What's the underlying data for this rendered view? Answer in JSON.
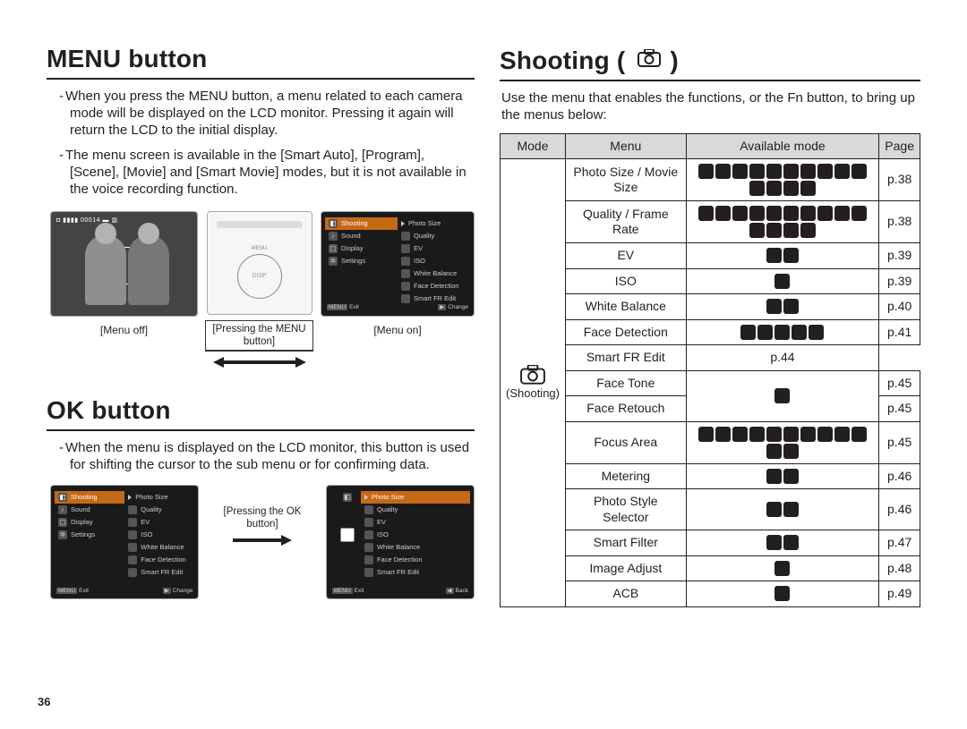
{
  "page_number": "36",
  "left": {
    "menu_heading": "MENU button",
    "menu_p1": "When you press the MENU button, a menu related to each camera mode will be displayed on the LCD monitor. Pressing it again will return the LCD to the initial display.",
    "menu_p2": "The menu screen is available in the [Smart Auto], [Program], [Scene], [Movie] and [Smart Movie] modes, but it is not available in the voice recording function.",
    "fig_menuoff": "[Menu off]",
    "fig_pressing": "[Pressing the MENU button]",
    "fig_menuon": "[Menu on]",
    "menu_left_items": [
      "Shooting",
      "Sound",
      "Display",
      "Settings"
    ],
    "menu_right_items": [
      "Photo Size",
      "Quality",
      "EV",
      "ISO",
      "White Balance",
      "Face Detection",
      "Smart FR Edit"
    ],
    "menu_foot_exit": "Exit",
    "menu_foot_change": "Change",
    "menu_foot_back": "Back",
    "menu_foot_menu": "MENU",
    "ok_heading": "OK button",
    "ok_p1": "When the menu is displayed on the LCD monitor, this button is used for shifting the cursor to the sub menu or for confirming data.",
    "ok_pressing": "[Pressing the OK button]",
    "cam_disp": "DISP"
  },
  "right": {
    "heading": "Shooting (",
    "heading_tail": ")",
    "intro": "Use the menu that enables the functions, or the Fn button, to bring up the menus below:",
    "th_mode": "Mode",
    "th_menu": "Menu",
    "th_avail": "Available mode",
    "th_page": "Page",
    "mode_label": "(Shooting)",
    "rows": [
      {
        "menu": "Photo Size / Movie Size",
        "icons": 14,
        "page": "p.38"
      },
      {
        "menu": "Quality / Frame Rate",
        "icons": 14,
        "page": "p.38"
      },
      {
        "menu": "EV",
        "icons": 2,
        "page": "p.39"
      },
      {
        "menu": "ISO",
        "icons": 1,
        "page": "p.39"
      },
      {
        "menu": "White Balance",
        "icons": 2,
        "page": "p.40"
      },
      {
        "menu": "Face Detection",
        "icons": 5,
        "page": "p.41"
      },
      {
        "menu": "Smart FR Edit",
        "icons": 5,
        "page": "p.44",
        "share": "up"
      },
      {
        "menu": "Face Tone",
        "icons": 1,
        "page": "p.45",
        "share": "down"
      },
      {
        "menu": "Face Retouch",
        "icons": 1,
        "page": "p.45",
        "share": "up"
      },
      {
        "menu": "Focus Area",
        "icons": 12,
        "page": "p.45"
      },
      {
        "menu": "Metering",
        "icons": 2,
        "page": "p.46"
      },
      {
        "menu": "Photo Style Selector",
        "icons": 2,
        "page": "p.46"
      },
      {
        "menu": "Smart Filter",
        "icons": 2,
        "page": "p.47"
      },
      {
        "menu": "Image Adjust",
        "icons": 1,
        "page": "p.48"
      },
      {
        "menu": "ACB",
        "icons": 1,
        "page": "p.49"
      }
    ]
  }
}
